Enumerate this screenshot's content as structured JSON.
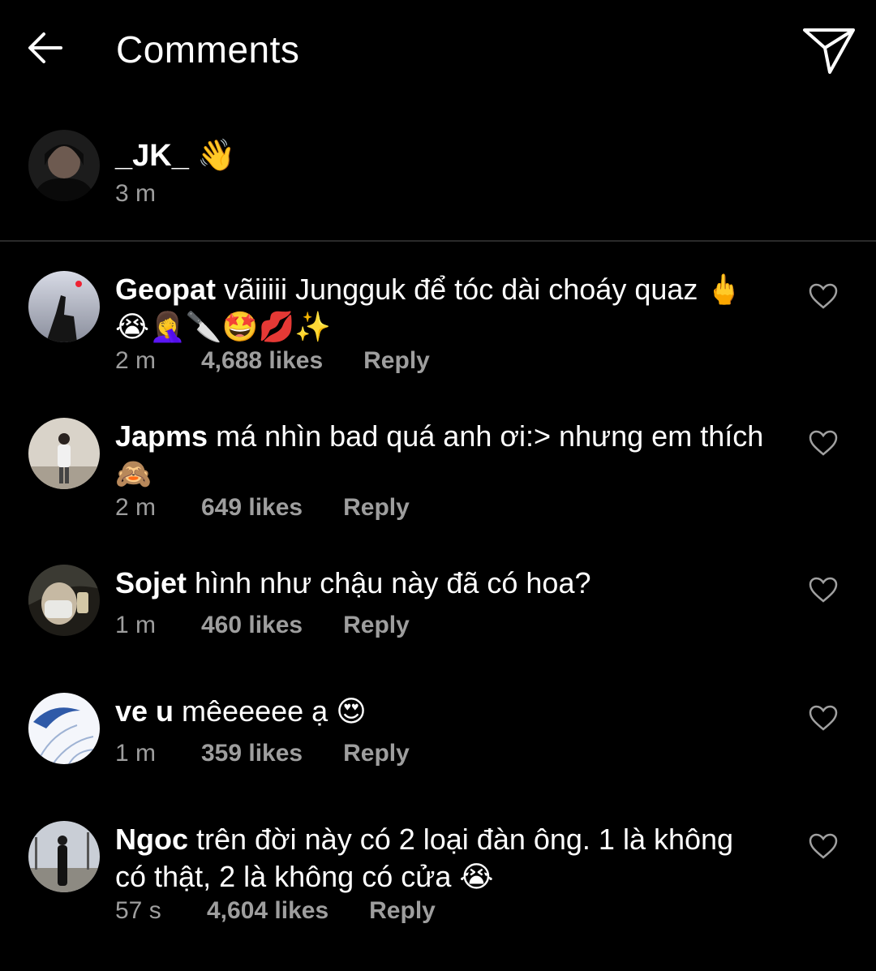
{
  "header": {
    "title": "Comments"
  },
  "caption": {
    "user": "_JK_",
    "emoji": "👋",
    "time": "3 m"
  },
  "comments": [
    {
      "user": "Geopat",
      "text": "vãiiiii Jungguk để tóc dài choáy quaz 🖕😭🤦‍♀️🔪🤩💋✨",
      "time": "2 m",
      "likes": "4,688 likes",
      "reply": "Reply"
    },
    {
      "user": "Japms",
      "text": "má nhìn bad quá anh ơi:> nhưng em thích 🙈",
      "time": "2 m",
      "likes": "649 likes",
      "reply": "Reply"
    },
    {
      "user": "Sojet",
      "text": "hình như chậu này đã có hoa?",
      "time": "1 m",
      "likes": "460 likes",
      "reply": "Reply"
    },
    {
      "user": "ve u",
      "text": "mêeeeee ạ 😍",
      "time": "1 m",
      "likes": "359 likes",
      "reply": "Reply"
    },
    {
      "user": "Ngoc",
      "text": "trên đời này có 2 loại đàn ông. 1 là không có thật, 2 là không có cửa 😭",
      "time": "57 s",
      "likes": "4,604 likes",
      "reply": "Reply"
    }
  ]
}
